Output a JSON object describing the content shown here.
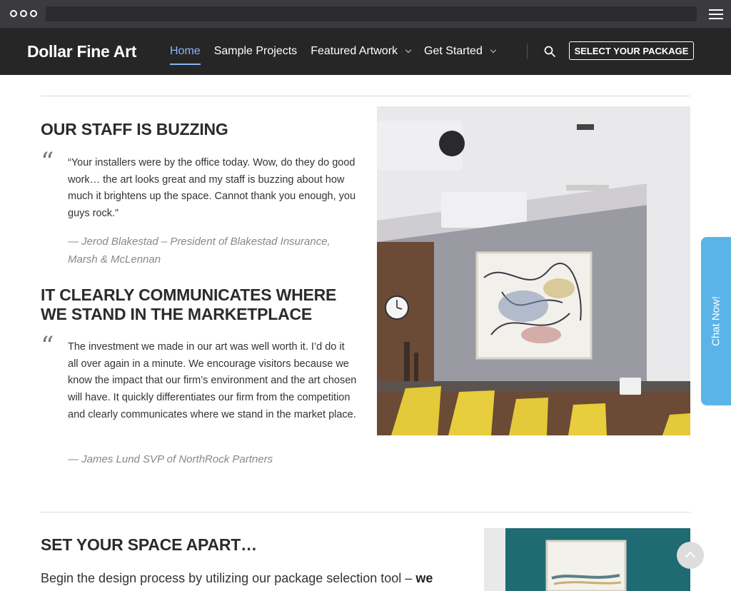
{
  "site": {
    "logo": "Dollar Fine Art",
    "nav": [
      {
        "label": "Home",
        "active": true
      },
      {
        "label": "Sample Projects"
      },
      {
        "label": "Featured Artwork",
        "dropdown": true
      },
      {
        "label": "Get Started",
        "dropdown": true
      }
    ],
    "cta_button": "SELECT YOUR PACKAGE"
  },
  "testimonials": [
    {
      "heading": "OUR STAFF IS BUZZING",
      "quote_mark": "“",
      "quote": "“Your installers were by the office today. Wow, do they do good work… the art looks great and my staff is buzzing about how much it brightens up the space. Cannot thank you enough, you guys rock.”",
      "attribution": "— Jerod Blakestad – President of Blakestad Insurance, Marsh & McLennan"
    },
    {
      "heading": "IT CLEARLY COMMUNICATES WHERE WE STAND IN THE MARKETPLACE",
      "quote_mark": "“",
      "quote": "The investment we made in our art was well worth it. I’d do it all over again in a minute. We encourage visitors because we know the impact that our firm’s environment and the art chosen will have. It quickly differentiates our firm from the competition and clearly communicates where we stand in the market place.",
      "attribution": "— James Lund SVP of NorthRock Partners"
    }
  ],
  "section2": {
    "heading": "SET YOUR SPACE APART…",
    "intro": "Begin the design process by utilizing our package selection tool –",
    "intro_bold": "we"
  },
  "chat": {
    "label": "Chat Now!"
  },
  "icons": {
    "window": "window-dots-icon",
    "menu": "hamburger-menu-icon",
    "search": "search-icon",
    "dropdown": "chevron-down-icon",
    "scroll_top": "chevron-up-icon"
  },
  "colors": {
    "header_bg": "#262626",
    "active_nav": "#8ab4f8",
    "chat_tab": "#5ab4e8"
  }
}
